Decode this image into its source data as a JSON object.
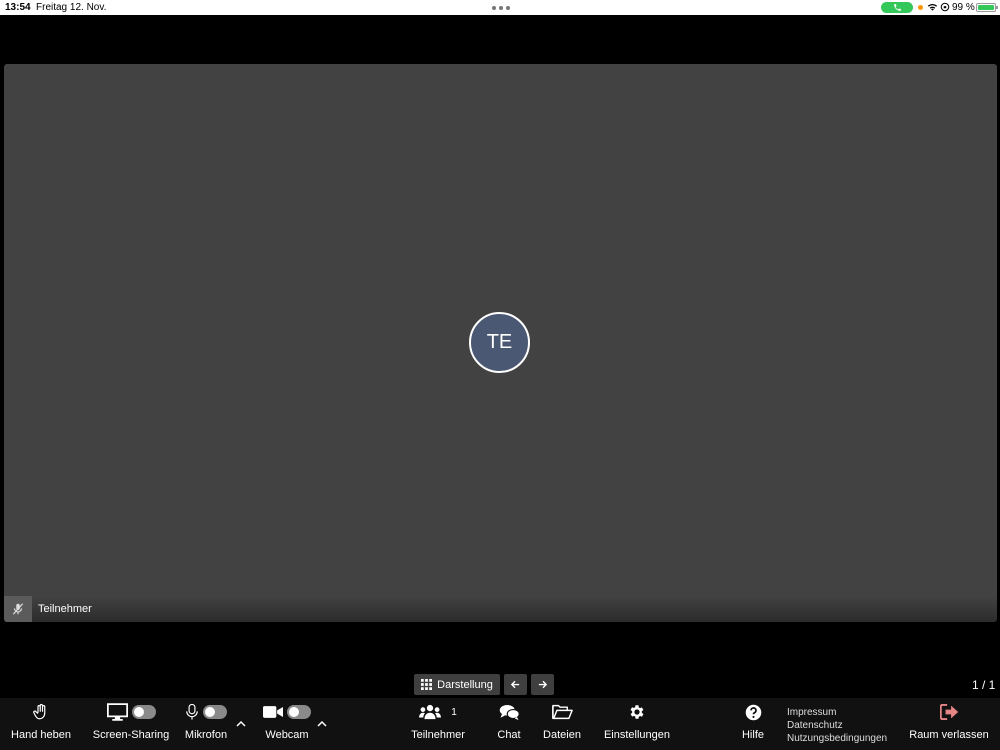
{
  "status_bar": {
    "time": "13:54",
    "date": "Freitag 12. Nov.",
    "battery_percent": "99 %",
    "battery_level": 0.99
  },
  "tile": {
    "avatar_initials": "TE",
    "participant_name": "Teilnehmer",
    "avatar_color": "#4a5873",
    "mic_muted": true
  },
  "layout": {
    "view_label": "Darstellung",
    "page_indicator": "1 / 1"
  },
  "toolbar": {
    "raise_hand": "Hand heben",
    "screen_sharing": "Screen-Sharing",
    "microphone": "Mikrofon",
    "webcam": "Webcam",
    "participants": "Teilnehmer",
    "participants_count": "1",
    "chat": "Chat",
    "files": "Dateien",
    "settings": "Einstellungen",
    "help": "Hilfe",
    "leave": "Raum verlassen",
    "leave_color": "#e58585"
  },
  "legal_links": {
    "imprint": "Impressum",
    "privacy": "Datenschutz",
    "terms": "Nutzungsbedingungen"
  }
}
